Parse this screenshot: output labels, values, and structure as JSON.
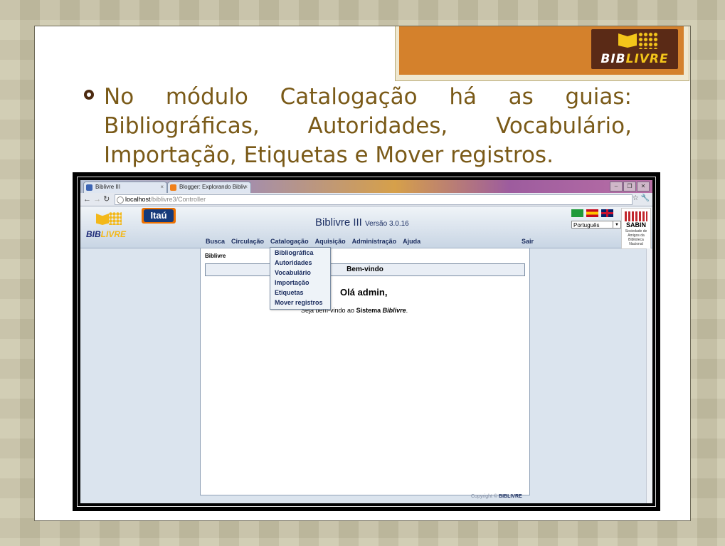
{
  "slide": {
    "logo_text_left": "BIB",
    "logo_text_right": "LIVRE",
    "body_text": "No módulo Catalogação há as guias: Bibliográficas, Autoridades, Vocabulário, Importação, Etiquetas e Mover registros."
  },
  "browser": {
    "tabs": [
      {
        "label": "Biblivre III",
        "favicon_color": "#3c64b4"
      },
      {
        "label": "Blogger: Explorando Bibliv",
        "favicon_color": "#f0801a"
      }
    ],
    "url_host": "localhost",
    "url_path": "/biblivre3/Controller"
  },
  "app": {
    "itau_label": "Itaú",
    "title": "Biblivre III",
    "version": "Versão 3.0.16",
    "language": "Português",
    "sabin_title": "SABIN",
    "sabin_sub": "Sociedade de Amigos da Biblioteca Nacional",
    "menu": [
      "Busca",
      "Circulação",
      "Catalogação",
      "Aquisição",
      "Administração",
      "Ajuda"
    ],
    "logout": "Sair",
    "breadcrumb": "Biblivre",
    "welcome_header": "Bem-vindo",
    "greeting": "Olá admin,",
    "welcome_prefix": "Seja bem-vindo ao",
    "welcome_system": "Sistema",
    "welcome_brand": "Biblivre",
    "welcome_suffix": ".",
    "dropdown": [
      "Bibliográfica",
      "Autoridades",
      "Vocabulário",
      "Importação",
      "Etiquetas",
      "Mover registros"
    ],
    "copyright_prefix": "Copyright ©",
    "copyright_brand": "BIBLIVRE"
  }
}
